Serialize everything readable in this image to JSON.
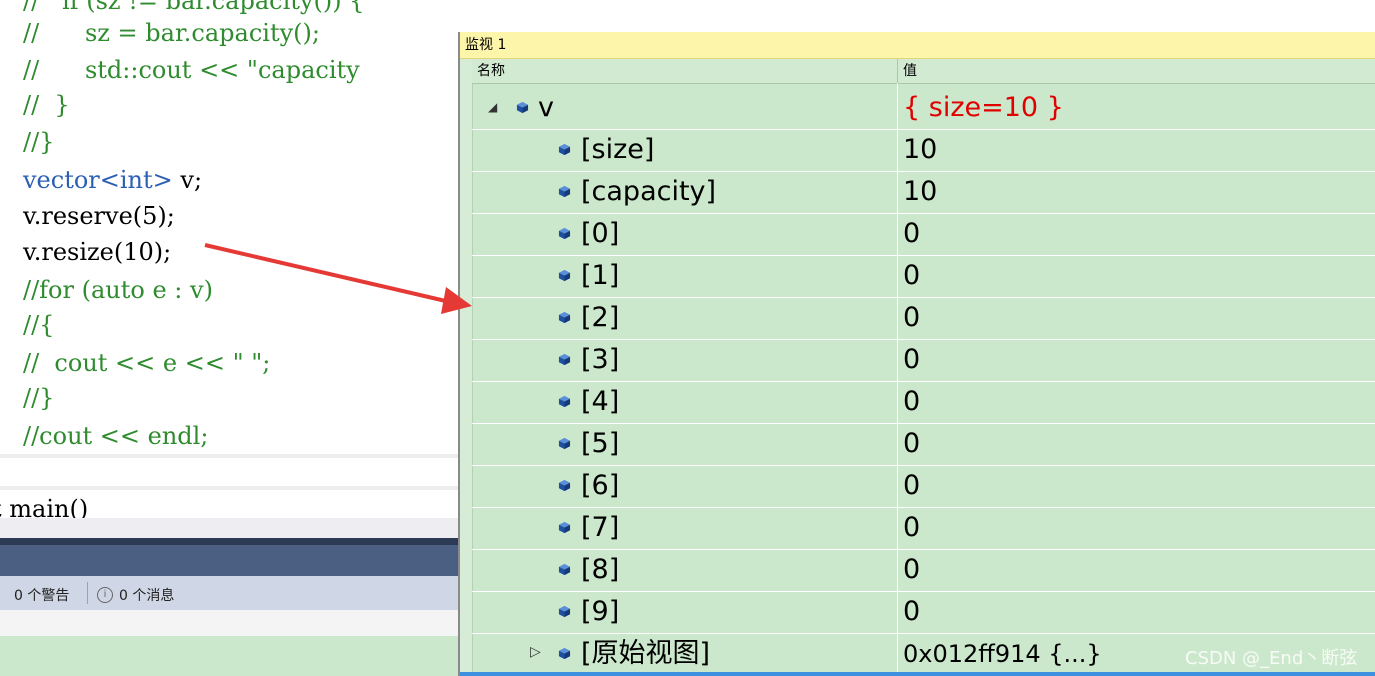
{
  "editor": {
    "code_lines": [
      "//   if (sz != bar.capacity()) {",
      "//      sz = bar.capacity();",
      "//      std::cout << \"capacity",
      "//  }",
      "//}",
      "vector<int> v;",
      "v.reserve(5);",
      "v.resize(10);",
      "//for (auto e : v)",
      "//{",
      "//  cout << e << \" \";",
      "//}",
      "//cout << endl;"
    ],
    "main_line": "t main()"
  },
  "error_list": {
    "warnings": "0 个警告",
    "messages": "0 个消息"
  },
  "watch": {
    "title": "监视 1",
    "col_name": "名称",
    "col_value": "值",
    "rows": [
      {
        "name": "v",
        "value": "{ size=10 }"
      },
      {
        "name": "[size]",
        "value": "10"
      },
      {
        "name": "[capacity]",
        "value": "10"
      },
      {
        "name": "[0]",
        "value": "0"
      },
      {
        "name": "[1]",
        "value": "0"
      },
      {
        "name": "[2]",
        "value": "0"
      },
      {
        "name": "[3]",
        "value": "0"
      },
      {
        "name": "[4]",
        "value": "0"
      },
      {
        "name": "[5]",
        "value": "0"
      },
      {
        "name": "[6]",
        "value": "0"
      },
      {
        "name": "[7]",
        "value": "0"
      },
      {
        "name": "[8]",
        "value": "0"
      },
      {
        "name": "[9]",
        "value": "0"
      },
      {
        "name": "[原始视图]",
        "value": "0x012ff914 {...}"
      }
    ]
  },
  "watermark": "CSDN @_End丶断弦",
  "colors": {
    "watch_bg": "#cce8cc",
    "title_bg": "#fdf5a9",
    "value_highlight": "#e00000",
    "arrow": "#e53935",
    "comment": "#2e8b2e",
    "keyword": "#2b5fb4"
  },
  "icons": {
    "field": "blue-cube-icon",
    "expanded": "triangle-expanded-icon",
    "collapsed": "triangle-collapsed-icon",
    "warning": "warning-icon",
    "message": "info-icon"
  }
}
